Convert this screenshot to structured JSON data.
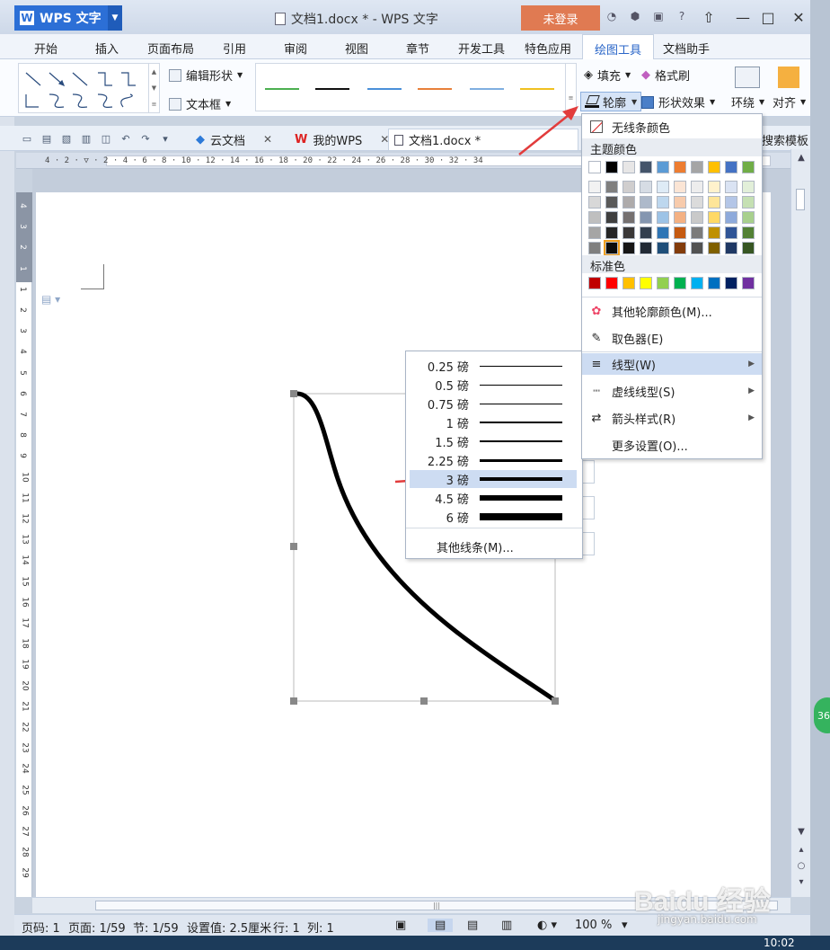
{
  "app": {
    "logo_label": "WPS 文字",
    "window_title": "文档1.docx * - WPS 文字",
    "login_label": "未登录"
  },
  "menu_tabs": [
    "开始",
    "插入",
    "页面布局",
    "引用",
    "审阅",
    "视图",
    "章节",
    "开发工具",
    "特色应用",
    "绘图工具",
    "文档助手"
  ],
  "ribbon": {
    "edit_shape": "编辑形状",
    "text_box": "文本框",
    "fill": "填充",
    "format_painter": "格式刷",
    "outline": "轮廓",
    "shape_effect": "形状效果",
    "wrap": "环绕",
    "align": "对齐",
    "line_colors": [
      "#4caf50",
      "#111111",
      "#4a90d9",
      "#e8803a",
      "#7faee0",
      "#f0c020"
    ]
  },
  "doc_tabs": {
    "cloud": "云文档",
    "mywps": "我的WPS",
    "doc": "文档1.docx *",
    "search_template": "搜索模板"
  },
  "ruler_text": "4 · 2 · ▽ · 2 · 4 · 6 · 8 · 10 · 12 · 14 · 16 · 18 · 20 · 22 · 24 · 26 · 28 · 30 · 32 · 34",
  "vruler_nums": [
    "4",
    "3",
    "2",
    "1",
    "1",
    "2",
    "3",
    "4",
    "5",
    "6",
    "7",
    "8",
    "9",
    "10",
    "11",
    "12",
    "13",
    "14",
    "15",
    "16",
    "17",
    "18",
    "19",
    "20",
    "21",
    "22",
    "23",
    "24",
    "25",
    "26",
    "27",
    "28",
    "29"
  ],
  "weight_menu": {
    "items": [
      {
        "label": "0.25 磅",
        "weight": 1
      },
      {
        "label": "0.5 磅",
        "weight": 1
      },
      {
        "label": "0.75 磅",
        "weight": 1
      },
      {
        "label": "1 磅",
        "weight": 2
      },
      {
        "label": "1.5 磅",
        "weight": 2
      },
      {
        "label": "2.25 磅",
        "weight": 3
      },
      {
        "label": "3 磅",
        "weight": 4
      },
      {
        "label": "4.5 磅",
        "weight": 6
      },
      {
        "label": "6 磅",
        "weight": 8
      }
    ],
    "selected": "3 磅",
    "more": "其他线条(M)..."
  },
  "color_menu": {
    "no_line": "无线条颜色",
    "theme_header": "主题颜色",
    "theme_top": [
      "#ffffff",
      "#000000",
      "#e7e6e6",
      "#44546a",
      "#5b9bd5",
      "#ed7d31",
      "#a5a5a5",
      "#ffc000",
      "#4472c4",
      "#70ad47"
    ],
    "theme_shades": [
      [
        "#f2f2f2",
        "#7f7f7f",
        "#d0cece",
        "#d6dce4",
        "#deebf6",
        "#fbe5d5",
        "#ededed",
        "#fff2cc",
        "#dae3f3",
        "#e2efd9"
      ],
      [
        "#d8d8d8",
        "#595959",
        "#aeabab",
        "#adb9ca",
        "#bdd7ee",
        "#f7cbac",
        "#dbdbdb",
        "#fee599",
        "#b4c6e7",
        "#c5e0b3"
      ],
      [
        "#bfbfbf",
        "#3f3f3f",
        "#757070",
        "#8496b0",
        "#9dc3e6",
        "#f4b183",
        "#c9c9c9",
        "#ffd966",
        "#8eaadb",
        "#a8d08d"
      ],
      [
        "#a5a5a5",
        "#262626",
        "#3a3838",
        "#323f4f",
        "#2e75b5",
        "#c55a11",
        "#7b7b7b",
        "#bf9000",
        "#2f5496",
        "#538135"
      ],
      [
        "#7f7f7f",
        "#0c0c0c",
        "#171616",
        "#222a35",
        "#1e4e79",
        "#833c0b",
        "#525252",
        "#7f6000",
        "#1f3864",
        "#375623"
      ]
    ],
    "selected_swatch": "#0c0c0c",
    "standard_header": "标准色",
    "standard": [
      "#c00000",
      "#ff0000",
      "#ffc000",
      "#ffff00",
      "#92d050",
      "#00b050",
      "#00b0f0",
      "#0070c0",
      "#002060",
      "#7030a0"
    ],
    "other_color": "其他轮廓颜色(M)...",
    "eyedropper": "取色器(E)",
    "line_type": "线型(W)",
    "dash_type": "虚线线型(S)",
    "arrow_style": "箭头样式(R)",
    "more_settings": "更多设置(O)..."
  },
  "status": {
    "page_code": "页码: 1",
    "page": "页面: 1/59",
    "section": "节: 1/59",
    "setting": "设置值: 2.5厘米",
    "row": "行: 1",
    "col": "列: 1",
    "zoom": "100 %"
  },
  "clock": "10:02",
  "watermark": "Baidu 经验",
  "watermark_sub": "jingyan.baidu.com"
}
